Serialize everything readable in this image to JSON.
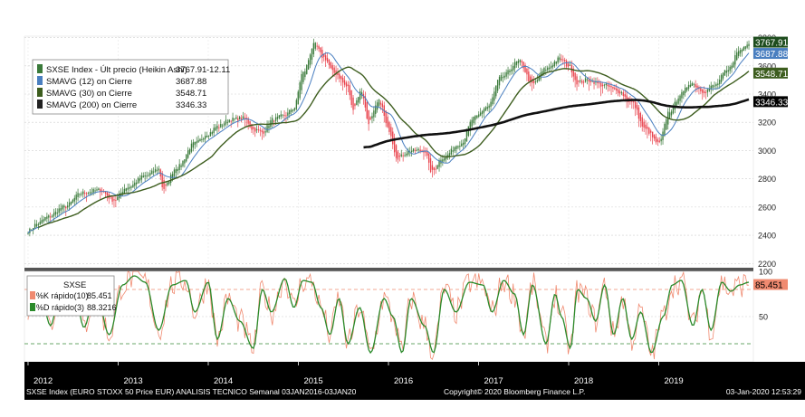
{
  "chart_data": [
    {
      "type": "candlestick",
      "title": "SXSE Index - Últ precio (Heikin Ashi)",
      "legend": {
        "placement": "top-left",
        "entries": [
          {
            "label": "SXSE Index - Últ precio (Heikin Ashi)",
            "value": "3767.91",
            "change": "-12.11",
            "color": "#3a7a3a"
          },
          {
            "label": "SMAVG (12)  on Cierre",
            "value": "3687.88",
            "color": "#4a7fc0"
          },
          {
            "label": "SMAVG (30)  on Cierre",
            "value": "3548.71",
            "color": "#3d5d1e"
          },
          {
            "label": "SMAVG (200)  on Cierre",
            "value": "3346.33",
            "color": "#222222"
          }
        ]
      },
      "ylim": [
        2170,
        3810
      ],
      "y_ticks": [
        "2200",
        "2400",
        "2600",
        "2800",
        "3000",
        "3200",
        "3400",
        "3600",
        "3800"
      ],
      "price_anchors": [
        [
          2012.0,
          2430
        ],
        [
          2012.1,
          2480
        ],
        [
          2012.22,
          2530
        ],
        [
          2012.4,
          2600
        ],
        [
          2012.6,
          2700
        ],
        [
          2012.8,
          2720
        ],
        [
          2012.95,
          2650
        ],
        [
          2013.1,
          2740
        ],
        [
          2013.3,
          2820
        ],
        [
          2013.45,
          2870
        ],
        [
          2013.5,
          2730
        ],
        [
          2013.65,
          2880
        ],
        [
          2013.85,
          3050
        ],
        [
          2014.0,
          3120
        ],
        [
          2014.1,
          3170
        ],
        [
          2014.25,
          3220
        ],
        [
          2014.4,
          3230
        ],
        [
          2014.5,
          3150
        ],
        [
          2014.6,
          3130
        ],
        [
          2014.72,
          3220
        ],
        [
          2014.85,
          3250
        ],
        [
          2014.95,
          3300
        ],
        [
          2015.05,
          3550
        ],
        [
          2015.18,
          3750
        ],
        [
          2015.28,
          3660
        ],
        [
          2015.4,
          3550
        ],
        [
          2015.55,
          3450
        ],
        [
          2015.6,
          3300
        ],
        [
          2015.7,
          3420
        ],
        [
          2015.78,
          3200
        ],
        [
          2015.9,
          3350
        ],
        [
          2016.0,
          3150
        ],
        [
          2016.1,
          2950
        ],
        [
          2016.25,
          3000
        ],
        [
          2016.4,
          3000
        ],
        [
          2016.48,
          2850
        ],
        [
          2016.6,
          2950
        ],
        [
          2016.8,
          3050
        ],
        [
          2016.95,
          3230
        ],
        [
          2017.1,
          3310
        ],
        [
          2017.25,
          3520
        ],
        [
          2017.45,
          3630
        ],
        [
          2017.6,
          3470
        ],
        [
          2017.75,
          3580
        ],
        [
          2017.9,
          3650
        ],
        [
          2018.0,
          3600
        ],
        [
          2018.1,
          3480
        ],
        [
          2018.2,
          3500
        ],
        [
          2018.4,
          3460
        ],
        [
          2018.55,
          3420
        ],
        [
          2018.7,
          3340
        ],
        [
          2018.85,
          3150
        ],
        [
          2019.0,
          3050
        ],
        [
          2019.12,
          3280
        ],
        [
          2019.25,
          3400
        ],
        [
          2019.35,
          3480
        ],
        [
          2019.5,
          3420
        ],
        [
          2019.62,
          3460
        ],
        [
          2019.75,
          3560
        ],
        [
          2019.9,
          3710
        ],
        [
          2020.0,
          3768
        ]
      ],
      "series_end_values": {
        "last_price": 3767.91,
        "smavg_12": 3687.88,
        "smavg_30": 3548.71,
        "smavg_200": 3346.33
      },
      "colors": {
        "up": "#3a7a3a",
        "down": "#e8404a"
      }
    },
    {
      "type": "line",
      "title": "SXSE",
      "legend": {
        "placement": "top-left",
        "entries": [
          {
            "label": "%K rápido(10)",
            "value": "85.451",
            "color": "#f08a70"
          },
          {
            "label": "%D rápido(3)",
            "value": "88.3216",
            "color": "#2a8a2a"
          }
        ]
      },
      "ylim": [
        0,
        100
      ],
      "y_ticks": [
        "50",
        "100"
      ],
      "reference_lines": [
        80,
        20
      ],
      "d_anchors": [
        [
          2012.0,
          60
        ],
        [
          2012.12,
          85
        ],
        [
          2012.25,
          40
        ],
        [
          2012.35,
          75
        ],
        [
          2012.5,
          88
        ],
        [
          2012.62,
          38
        ],
        [
          2012.75,
          80
        ],
        [
          2012.9,
          30
        ],
        [
          2013.05,
          85
        ],
        [
          2013.18,
          95
        ],
        [
          2013.3,
          88
        ],
        [
          2013.45,
          35
        ],
        [
          2013.6,
          85
        ],
        [
          2013.75,
          90
        ],
        [
          2013.85,
          55
        ],
        [
          2014.0,
          88
        ],
        [
          2014.1,
          25
        ],
        [
          2014.22,
          70
        ],
        [
          2014.35,
          45
        ],
        [
          2014.5,
          15
        ],
        [
          2014.6,
          80
        ],
        [
          2014.7,
          55
        ],
        [
          2014.85,
          92
        ],
        [
          2014.95,
          60
        ],
        [
          2015.05,
          90
        ],
        [
          2015.15,
          88
        ],
        [
          2015.25,
          60
        ],
        [
          2015.35,
          30
        ],
        [
          2015.45,
          70
        ],
        [
          2015.55,
          20
        ],
        [
          2015.68,
          60
        ],
        [
          2015.8,
          10
        ],
        [
          2015.95,
          70
        ],
        [
          2016.05,
          50
        ],
        [
          2016.15,
          10
        ],
        [
          2016.25,
          70
        ],
        [
          2016.4,
          40
        ],
        [
          2016.5,
          10
        ],
        [
          2016.62,
          80
        ],
        [
          2016.75,
          55
        ],
        [
          2016.9,
          88
        ],
        [
          2017.05,
          85
        ],
        [
          2017.15,
          55
        ],
        [
          2017.28,
          90
        ],
        [
          2017.4,
          75
        ],
        [
          2017.5,
          30
        ],
        [
          2017.6,
          85
        ],
        [
          2017.75,
          20
        ],
        [
          2017.85,
          75
        ],
        [
          2017.92,
          50
        ],
        [
          2018.02,
          15
        ],
        [
          2018.1,
          80
        ],
        [
          2018.2,
          70
        ],
        [
          2018.3,
          45
        ],
        [
          2018.4,
          85
        ],
        [
          2018.5,
          30
        ],
        [
          2018.6,
          70
        ],
        [
          2018.7,
          25
        ],
        [
          2018.8,
          55
        ],
        [
          2018.92,
          10
        ],
        [
          2019.05,
          50
        ],
        [
          2019.15,
          85
        ],
        [
          2019.25,
          90
        ],
        [
          2019.38,
          40
        ],
        [
          2019.48,
          80
        ],
        [
          2019.58,
          35
        ],
        [
          2019.7,
          88
        ],
        [
          2019.8,
          78
        ],
        [
          2019.9,
          85
        ],
        [
          2020.0,
          88
        ]
      ],
      "colors": {
        "k": "#f08a70",
        "d": "#2a8a2a"
      }
    }
  ],
  "x_axis": {
    "ticks": [
      {
        "label": "2012",
        "value": 2012
      },
      {
        "label": "2013",
        "value": 2013
      },
      {
        "label": "2014",
        "value": 2014
      },
      {
        "label": "2015",
        "value": 2015
      },
      {
        "label": "2016",
        "value": 2016
      },
      {
        "label": "2017",
        "value": 2017
      },
      {
        "label": "2018",
        "value": 2018
      },
      {
        "label": "2019",
        "value": 2019
      }
    ],
    "xlim": [
      2011.96,
      2020.05
    ]
  },
  "badges": {
    "price": {
      "text": "3767.91",
      "bg": "#1e4d1e",
      "fg": "#ffffff"
    },
    "sma12": {
      "text": "3687.88",
      "bg": "#4a7fc0",
      "fg": "#ffffff"
    },
    "sma30": {
      "text": "3548.71",
      "bg": "#3d5d1e",
      "fg": "#ffffff"
    },
    "sma200": {
      "text": "3346.33",
      "bg": "#000000",
      "fg": "#ffffff"
    },
    "stoch": {
      "text": "85.451",
      "bg": "#f08a70",
      "fg": "#000000"
    }
  },
  "footer": {
    "left": "SXSE Index (EURO STOXX 50 Price EUR) ANALISIS TECNICO  Semanal 03JAN2016-03JAN20",
    "center": "Copyright© 2020 Bloomberg Finance L.P.",
    "right": "03-Jan-2020 12:53:29"
  }
}
